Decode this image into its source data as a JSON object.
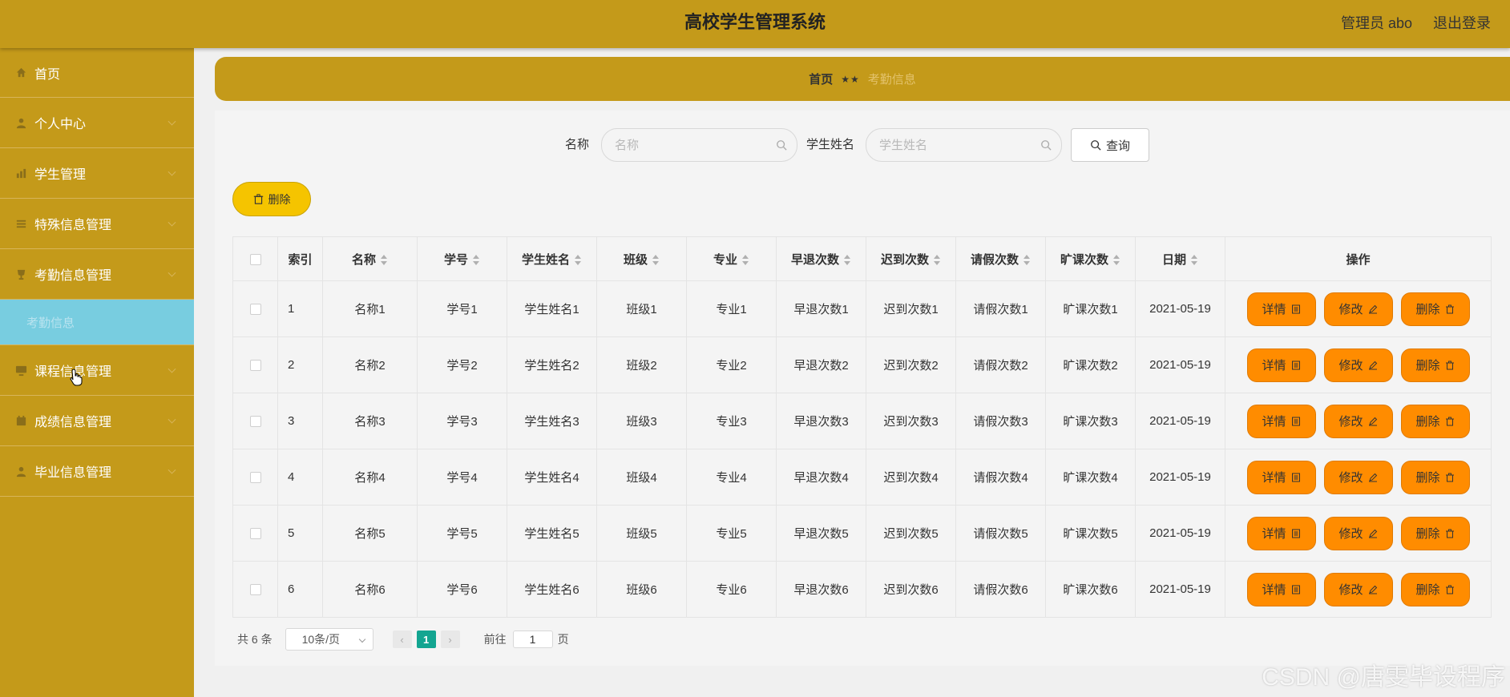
{
  "header": {
    "title": "高校学生管理系统",
    "admin": "管理员 abo",
    "logout": "退出登录"
  },
  "sidebar": {
    "items": [
      {
        "label": "首页",
        "icon": "home-icon"
      },
      {
        "label": "个人中心",
        "icon": "user-icon"
      },
      {
        "label": "学生管理",
        "icon": "chart-icon"
      },
      {
        "label": "特殊信息管理",
        "icon": "list-icon"
      },
      {
        "label": "考勤信息管理",
        "icon": "cup-icon"
      },
      {
        "label": "课程信息管理",
        "icon": "monitor-icon"
      },
      {
        "label": "成绩信息管理",
        "icon": "calendar-icon"
      },
      {
        "label": "毕业信息管理",
        "icon": "user-icon"
      }
    ],
    "active_sub": "考勤信息"
  },
  "breadcrumb": {
    "home": "首页",
    "sep": "★★",
    "current": "考勤信息"
  },
  "search": {
    "name_label": "名称",
    "name_placeholder": "名称",
    "student_label": "学生姓名",
    "student_placeholder": "学生姓名",
    "query_button": "查询"
  },
  "batch_delete": "删除",
  "table": {
    "headers": [
      "索引",
      "名称",
      "学号",
      "学生姓名",
      "班级",
      "专业",
      "早退次数",
      "迟到次数",
      "请假次数",
      "旷课次数",
      "日期",
      "操作"
    ],
    "rows": [
      [
        "1",
        "名称1",
        "学号1",
        "学生姓名1",
        "班级1",
        "专业1",
        "早退次数1",
        "迟到次数1",
        "请假次数1",
        "旷课次数1",
        "2021-05-19"
      ],
      [
        "2",
        "名称2",
        "学号2",
        "学生姓名2",
        "班级2",
        "专业2",
        "早退次数2",
        "迟到次数2",
        "请假次数2",
        "旷课次数2",
        "2021-05-19"
      ],
      [
        "3",
        "名称3",
        "学号3",
        "学生姓名3",
        "班级3",
        "专业3",
        "早退次数3",
        "迟到次数3",
        "请假次数3",
        "旷课次数3",
        "2021-05-19"
      ],
      [
        "4",
        "名称4",
        "学号4",
        "学生姓名4",
        "班级4",
        "专业4",
        "早退次数4",
        "迟到次数4",
        "请假次数4",
        "旷课次数4",
        "2021-05-19"
      ],
      [
        "5",
        "名称5",
        "学号5",
        "学生姓名5",
        "班级5",
        "专业5",
        "早退次数5",
        "迟到次数5",
        "请假次数5",
        "旷课次数5",
        "2021-05-19"
      ],
      [
        "6",
        "名称6",
        "学号6",
        "学生姓名6",
        "班级6",
        "专业6",
        "早退次数6",
        "迟到次数6",
        "请假次数6",
        "旷课次数6",
        "2021-05-19"
      ]
    ],
    "actions": {
      "detail": "详情",
      "edit": "修改",
      "delete": "删除"
    }
  },
  "pagination": {
    "total": "共 6 条",
    "page_size": "10条/页",
    "current": "1",
    "goto_label": "前往",
    "goto_value": "1",
    "page_unit": "页"
  },
  "watermark": "CSDN @唐雯毕设程序",
  "colors": {
    "primary": "#c49a1a",
    "action": "#ff8c00",
    "active_sub": "#78cde0",
    "page_active": "#13a591"
  }
}
